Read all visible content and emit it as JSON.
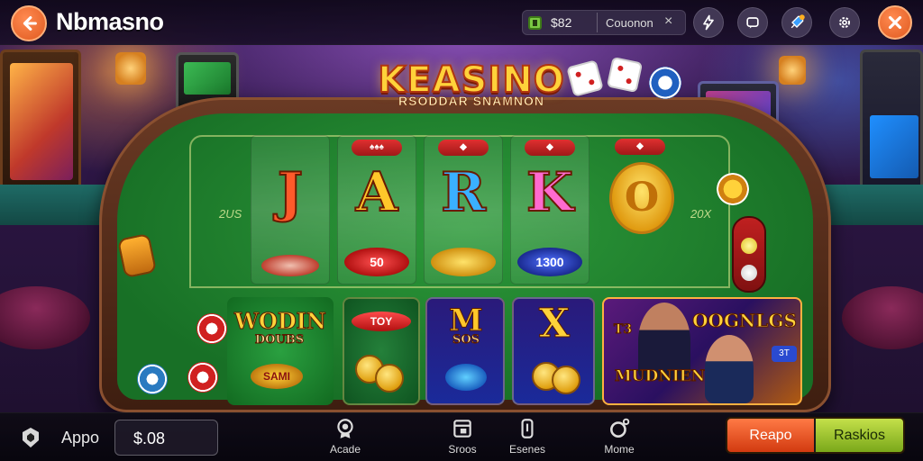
{
  "header": {
    "brand": "Nbmasno",
    "balance_amount": "$82",
    "balance_label": "Couonon",
    "balance_close": "×"
  },
  "game": {
    "logo_title": "KEASINO",
    "logo_subtitle": "RSODDAR SNAMNON",
    "felt_left": "2US",
    "felt_right": "20X",
    "reels": [
      {
        "letter": "J",
        "chip": ""
      },
      {
        "letter": "A",
        "chip": "50"
      },
      {
        "letter": "R",
        "chip": ""
      },
      {
        "letter": "K",
        "chip": "1300"
      }
    ],
    "coin_symbol": "O",
    "tiles": {
      "tile1_title": "WODIN",
      "tile1_subtitle": "DOUBS",
      "tile1_badge": "SAMI",
      "tile2_badge": "TOY",
      "tile3_title": "M",
      "tile3_subtitle": "SOS",
      "tile4_title": "X",
      "tile5_title": "OOGNLGS",
      "tile5_subtitle": "MUDNIEN",
      "tile5_left": "T3",
      "tile5_badge": "3T"
    }
  },
  "footer": {
    "name": "Appo",
    "balance": "$.08",
    "nav": [
      {
        "label": "Acade",
        "icon": "medal-icon"
      },
      {
        "label": "Sroos",
        "icon": "window-icon"
      },
      {
        "label": "Esenes",
        "icon": "card-icon"
      },
      {
        "label": "Mome",
        "icon": "profile-icon"
      }
    ],
    "btn_primary": "Reapo",
    "btn_secondary": "Raskios"
  },
  "colors": {
    "accent_orange": "#e05a20",
    "felt_green": "#187026",
    "logo_gold": "#ffd23a",
    "btn_green": "#7aa81a"
  }
}
